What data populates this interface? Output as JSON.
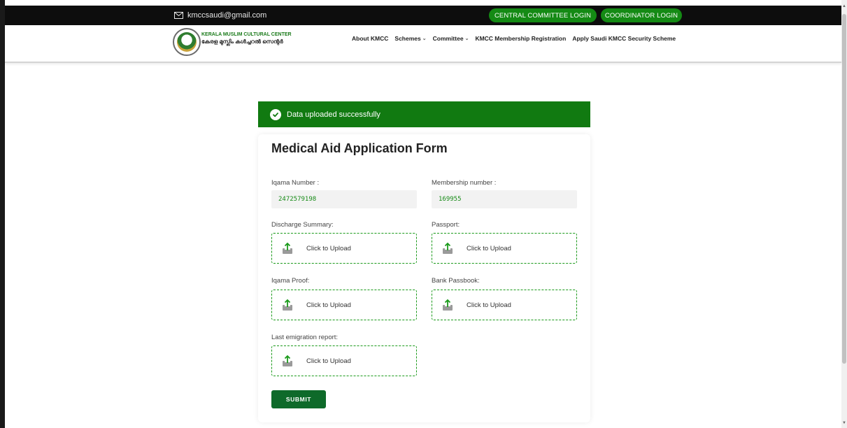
{
  "topbar": {
    "email": "kmccsaudi@gmail.com",
    "central_login": "CENTRAL COMMITTEE LOGIN",
    "coordinator_login": "COORDINATOR LOGIN"
  },
  "brand": {
    "name_en": "KERALA MUSLIM CULTURAL CENTER",
    "name_ml": "കേരള മുസ്ലിം കൾച്ചറൽ സെന്റർ"
  },
  "nav": {
    "items": [
      "About KMCC",
      "Schemes",
      "Committee",
      "KMCC Membership Registration",
      "Apply Saudi KMCC Security Scheme"
    ]
  },
  "alert": {
    "message": "Data uploaded successfully"
  },
  "form": {
    "title": "Medical Aid Application Form",
    "iqama_label": "Iqama Number :",
    "iqama_value": "2472579198",
    "membership_label": "Membership number :",
    "membership_value": "169955",
    "uploads": [
      {
        "label": "Discharge Summary:",
        "action": "Click to Upload"
      },
      {
        "label": "Passport:",
        "action": "Click to Upload"
      },
      {
        "label": "Iqama Proof:",
        "action": "Click to Upload"
      },
      {
        "label": "Bank Passbook:",
        "action": "Click to Upload"
      },
      {
        "label": "Last emigration report:",
        "action": "Click to Upload"
      }
    ],
    "submit_label": "SUBMIT"
  },
  "colors": {
    "brand_green": "#117a11",
    "pill_green": "#148a14",
    "submit_green": "#0e6a2a",
    "topbar_bg": "#0d0d0d"
  }
}
